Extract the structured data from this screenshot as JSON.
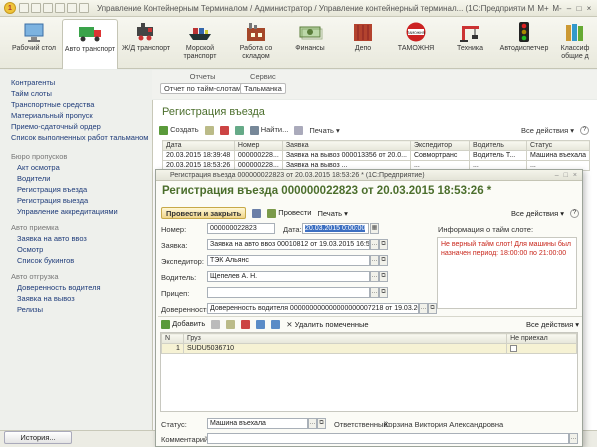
{
  "window": {
    "title": "Управление Контейнерным Терминалом / Администратор / Управление контейнерный терминал... (1С:Предприятие)",
    "controls": [
      "M",
      "M+",
      "M-",
      "–",
      "□",
      "×"
    ]
  },
  "toolbar": {
    "items": [
      {
        "label": "Рабочий стол"
      },
      {
        "label": "Авто транспорт"
      },
      {
        "label": "Ж/Д транспорт"
      },
      {
        "label": "Морской транспорт"
      },
      {
        "label": "Работа со складом"
      },
      {
        "label": "Финансы"
      },
      {
        "label": "Депо"
      },
      {
        "label": "ТАМОЖНЯ"
      },
      {
        "label": "Техника"
      },
      {
        "label": "Автодиспетчер"
      },
      {
        "label": "Классиф общие д"
      }
    ],
    "customs_logo": "ТАМОЖНЯ"
  },
  "sidebar": {
    "links_top": [
      "Контрагенты",
      "Тайм слоты",
      "Транспортные средства",
      "Материальный пропуск",
      "Приемо-сдаточный ордер",
      "Список выполненных работ тальманом"
    ],
    "groups": [
      {
        "title": "Бюро пропусков",
        "items": [
          "Акт осмотра",
          "Водители",
          "Регистрация въезда",
          "Регистрация выезда",
          "Управление аккредитациями"
        ]
      },
      {
        "title": "Авто приемка",
        "items": [
          "Заявка на авто ввоз",
          "Осмотр",
          "Список букингов"
        ]
      },
      {
        "title": "Авто отгрузка",
        "items": [
          "Доверенность водителя",
          "Заявка на вывоз",
          "Релизы"
        ]
      }
    ],
    "history": "История..."
  },
  "func_panel": {
    "groups": [
      {
        "title": "Отчеты",
        "button": "Отчет по тайм-слотам"
      },
      {
        "title": "Сервис",
        "button": "Тальманка"
      }
    ]
  },
  "list": {
    "title": "Регистрация въезда",
    "actions": [
      "Создать",
      "Найти...",
      "Печать"
    ],
    "all_actions": "Все действия",
    "columns": [
      "Дата",
      "Номер",
      "Заявка",
      "Экспедитор",
      "Водитель",
      "Статус"
    ],
    "rows": [
      [
        "20.03.2015 18:39:48",
        "000000228...",
        "Заявка на вывоз 000013356 от 20.0...",
        "Совмортранс",
        "Водитель Т...",
        "Машина въехала"
      ],
      [
        "20.03.2015 18:53:26",
        "000000228...",
        "Заявка на вывоз ...",
        "...",
        "...",
        "..."
      ]
    ]
  },
  "form": {
    "window_title": "Регистрация въезда 000000022823 от 20.03.2015 18:53:26 *  (1С:Предприятие)",
    "header": "Регистрация въезда 000000022823 от 20.03.2015 18:53:26 *",
    "btn_post_close": "Провести и закрыть",
    "btn_post": "Провести",
    "btn_print": "Печать",
    "all_actions": "Все действия",
    "fields": {
      "number_label": "Номер:",
      "number": "000000022823",
      "date_label": "Дата:",
      "date": "20.03.2015 0:00:00",
      "request_label": "Заявка:",
      "request": "Заявка на авто ввоз 00010812 от 19.03.2015 16:59:1",
      "forwarder_label": "Экспедитор:",
      "forwarder": "ТЭК Альянс",
      "driver_label": "Водитель:",
      "driver": "Щепелев А. Н.",
      "trailer_label": "Прицеп:",
      "trailer": "",
      "proxy_label": "Доверенность:",
      "proxy": "Доверенность водителя 000000000000000000007218 от 19.03.2015 16:5",
      "timeslot_label": "Информация о тайм слоте:",
      "timeslot_info": "Не верный тайм слот! Для машины был назначен период: 18:00:00 по 21:00:00"
    },
    "cargo": {
      "add": "Добавить",
      "remove_marked": "Удалить помеченные",
      "all_actions": "Все действия",
      "columns": [
        "N",
        "Груз",
        "Не приехал"
      ],
      "rows": [
        [
          "1",
          "SUDU5036710",
          ""
        ]
      ]
    },
    "status_label": "Статус:",
    "status": "Машина въехала",
    "responsible_label": "Ответственный:",
    "responsible": "Корзина Виктория Александровна",
    "comment_label": "Комментарий:",
    "comment": ""
  },
  "colors": {
    "accent_green": "#4b6e2c",
    "link_blue": "#1f3c7a",
    "warning_red": "#c8261b",
    "selection": "#3c6fc1"
  }
}
